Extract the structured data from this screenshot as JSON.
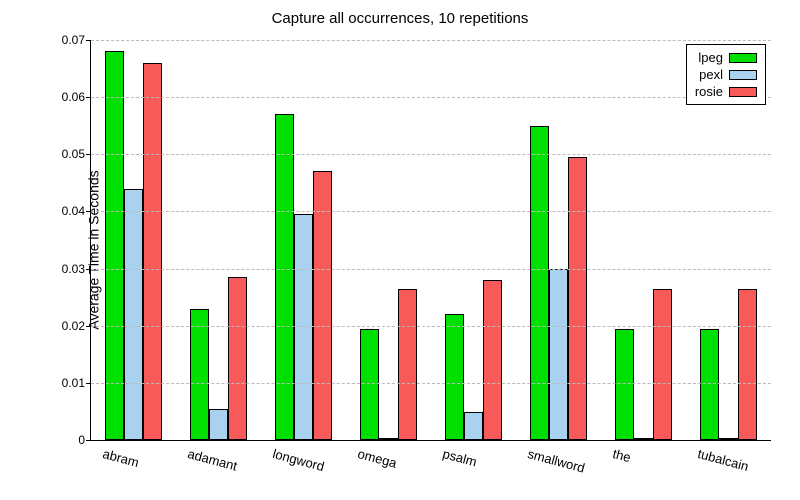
{
  "chart_data": {
    "type": "bar",
    "title": "Capture all occurrences, 10 repetitions",
    "xlabel": "",
    "ylabel": "Average Time in Seconds",
    "ylim": [
      0,
      0.07
    ],
    "yticks": [
      0,
      0.01,
      0.02,
      0.03,
      0.04,
      0.05,
      0.06,
      0.07
    ],
    "categories": [
      "abram",
      "adamant",
      "longword",
      "omega",
      "psalm",
      "smallword",
      "the",
      "tubalcain"
    ],
    "series": [
      {
        "name": "lpeg",
        "color": "#00e000",
        "values": [
          0.068,
          0.023,
          0.057,
          0.0195,
          0.022,
          0.055,
          0.0195,
          0.0195
        ]
      },
      {
        "name": "pexl",
        "color": "#a8d2f0",
        "values": [
          0.044,
          0.0055,
          0.0395,
          0.0003,
          0.0049,
          0.03,
          0.0003,
          0.0003
        ]
      },
      {
        "name": "rosie",
        "color": "#f85a5a",
        "values": [
          0.066,
          0.0285,
          0.047,
          0.0265,
          0.028,
          0.0495,
          0.0265,
          0.0265
        ]
      }
    ],
    "legend_position": "top-right",
    "grid": true
  }
}
